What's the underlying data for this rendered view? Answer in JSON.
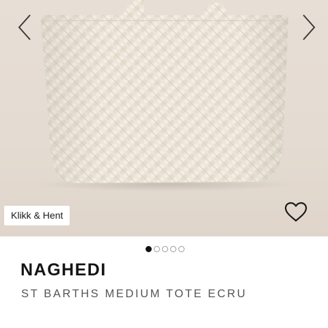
{
  "gallery": {
    "prev_icon": "chevron-left-icon",
    "next_icon": "chevron-right-icon",
    "badge_label": "Klikk & Hent",
    "wishlist_icon": "heart-outline-icon",
    "dots_total": 5,
    "dots_active": 1,
    "background_color": "#e4dbd2",
    "bag_color": "#ece4d7"
  },
  "product": {
    "brand": "NAGHEDI",
    "name": "ST BARTHS MEDIUM TOTE ECRU"
  }
}
